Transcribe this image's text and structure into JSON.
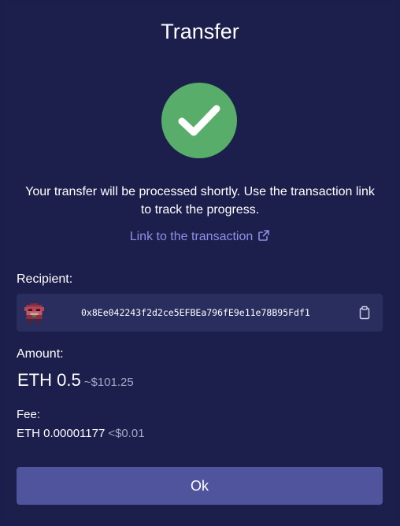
{
  "dialog": {
    "title": "Transfer",
    "message": "Your transfer will be processed shortly. Use the transaction link to track the progress.",
    "tx_link_label": "Link to the transaction"
  },
  "recipient": {
    "label": "Recipient:",
    "address": "0x8Ee042243f2d2ce5EFBEa796fE9e11e78B95Fdf1"
  },
  "amount": {
    "label": "Amount:",
    "value": "ETH 0.5",
    "usd": "~$101.25"
  },
  "fee": {
    "label": "Fee:",
    "value": "ETH 0.00001177",
    "usd": "<$0.01"
  },
  "actions": {
    "ok_label": "Ok"
  },
  "icons": {
    "success": "checkmark-circle-icon",
    "external_link": "external-link-icon",
    "copy": "clipboard-icon"
  },
  "colors": {
    "background": "#1c1f4b",
    "success": "#58ad6a",
    "link": "#8c8fe6",
    "field": "#2a2e5f",
    "button": "#4f549d",
    "muted": "#a5a8c8"
  }
}
